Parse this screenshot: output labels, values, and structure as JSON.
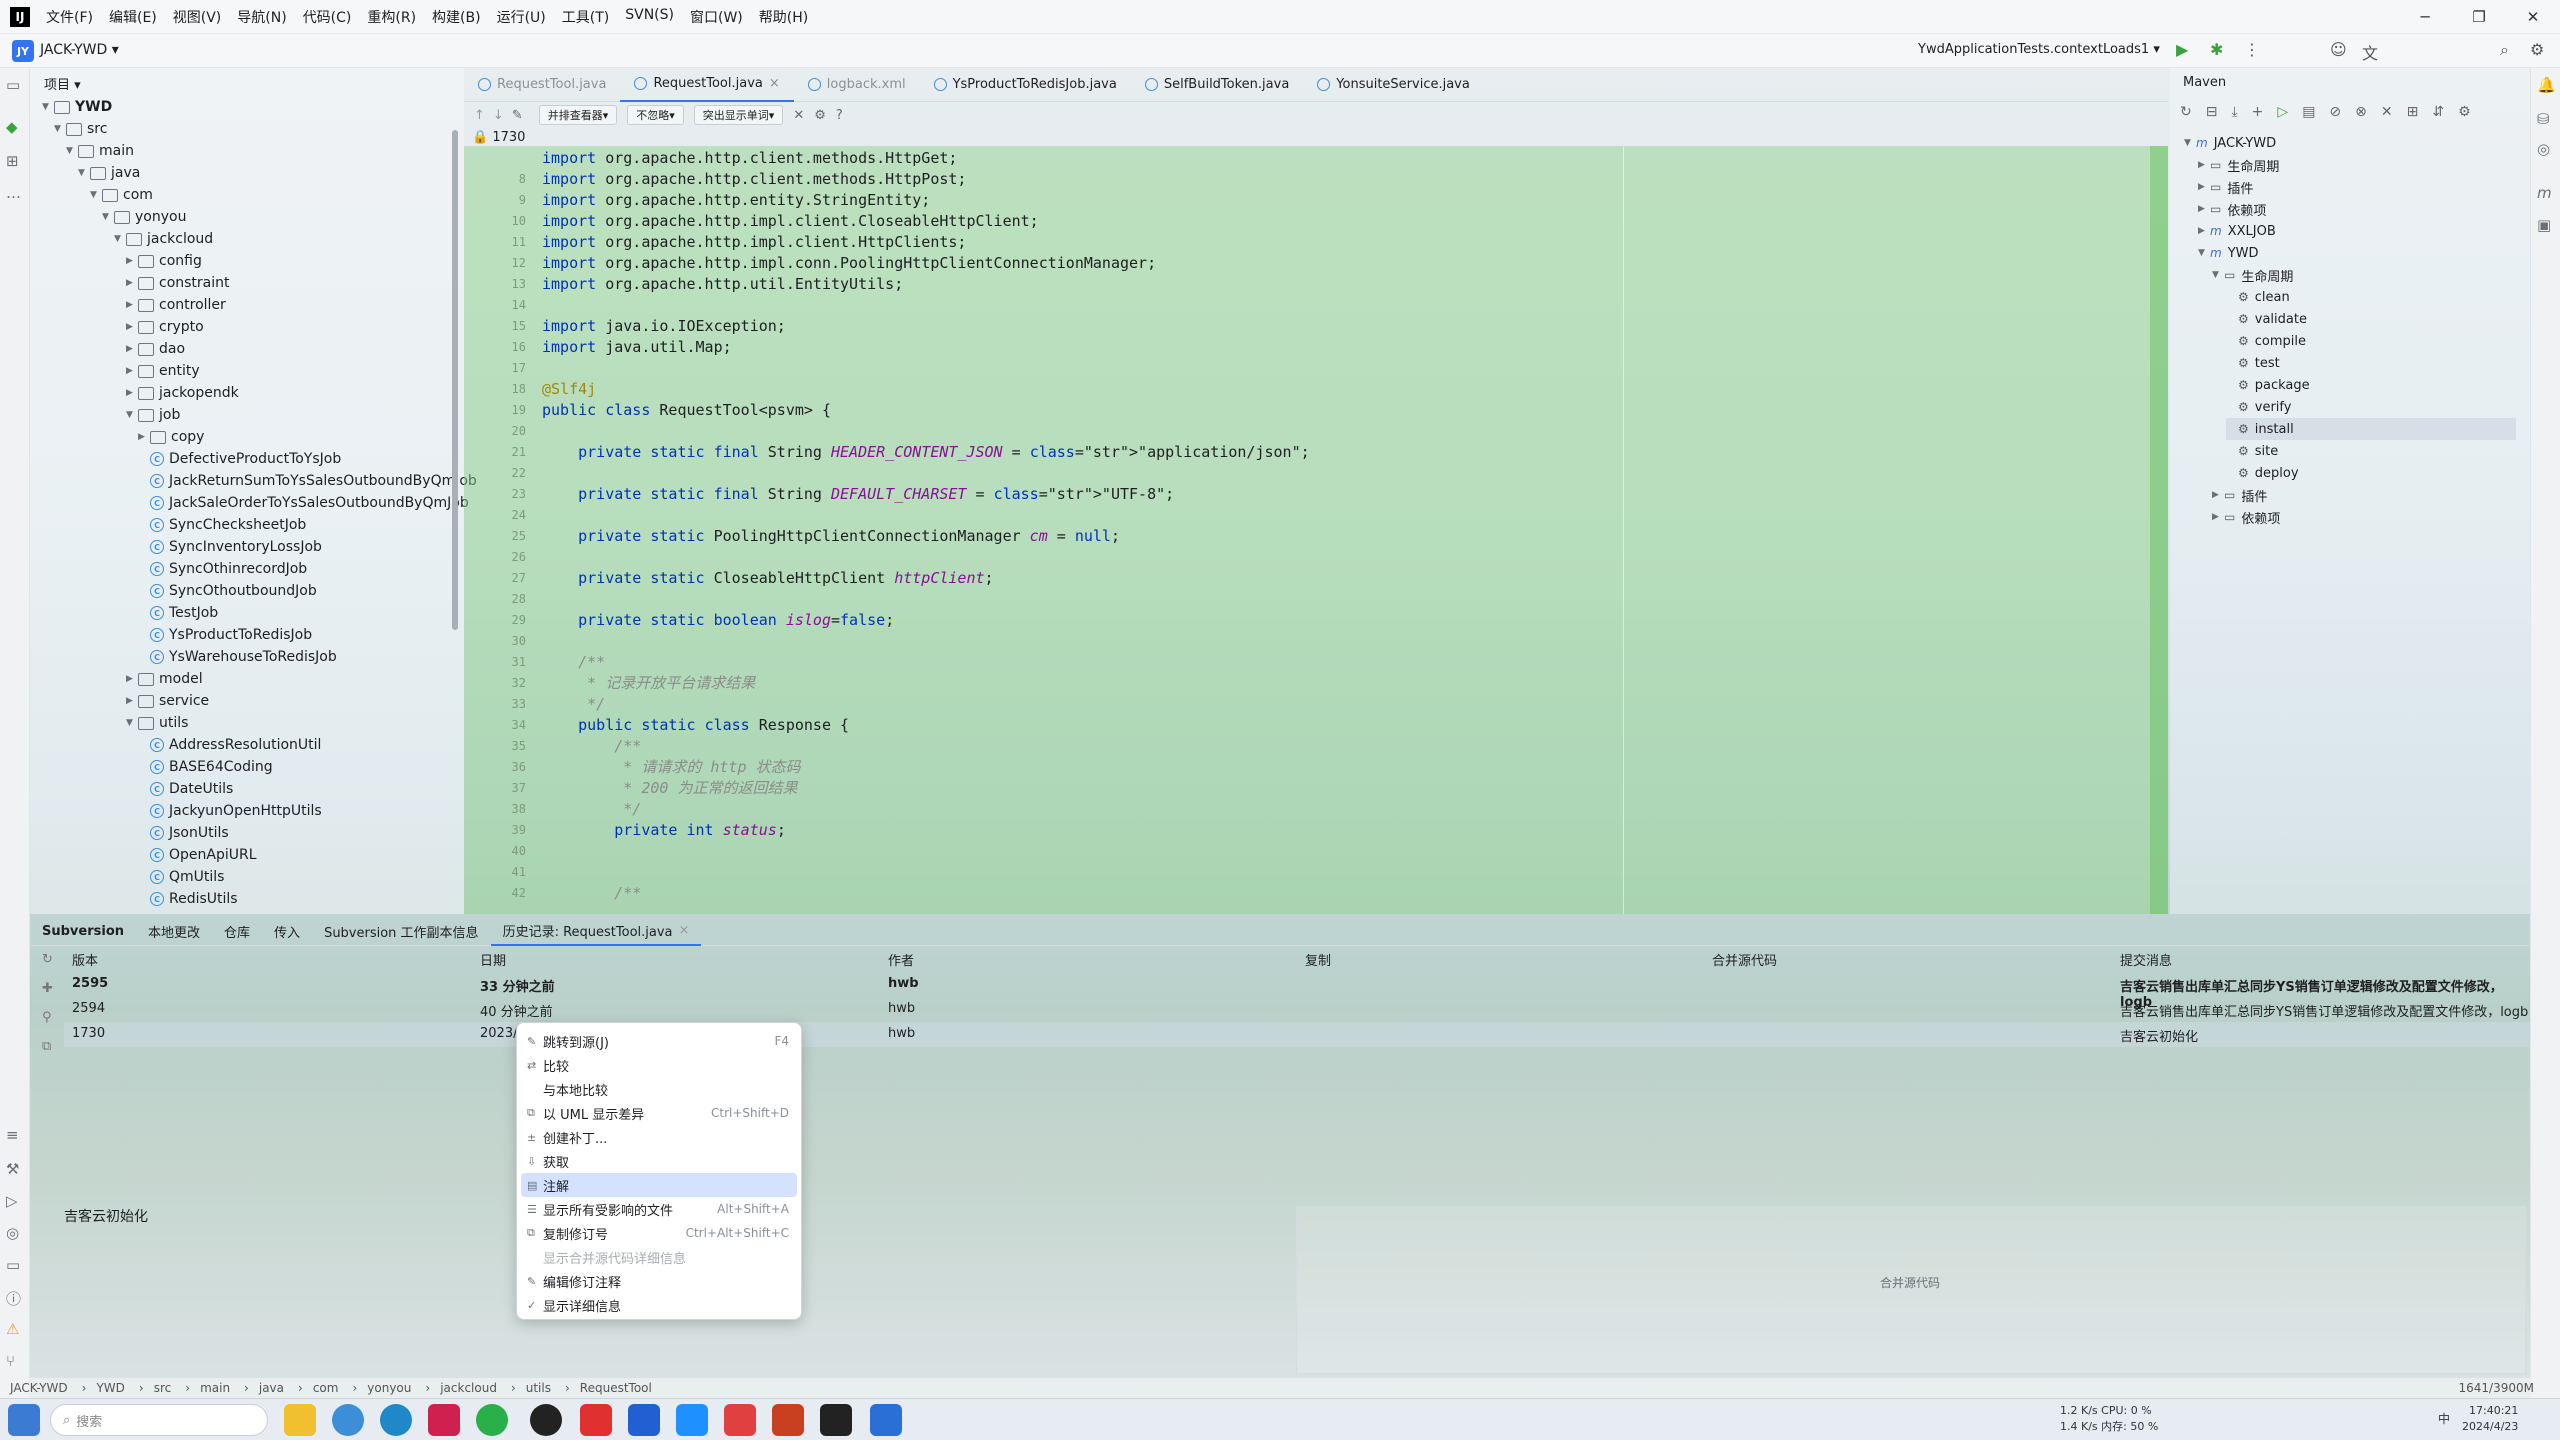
{
  "menu": [
    "文件(F)",
    "编辑(E)",
    "视图(V)",
    "导航(N)",
    "代码(C)",
    "重构(R)",
    "构建(B)",
    "运行(U)",
    "工具(T)",
    "SVN(S)",
    "窗口(W)",
    "帮助(H)"
  ],
  "project": {
    "badge": "JY",
    "name": "JACK-YWD",
    "panel_title": "项目"
  },
  "run_config": "YwdApplicationTests.contextLoads1",
  "tree": [
    {
      "label": "YWD",
      "depth": 1,
      "kind": "folder",
      "open": true,
      "bold": true
    },
    {
      "label": "src",
      "depth": 2,
      "kind": "folder",
      "open": true
    },
    {
      "label": "main",
      "depth": 3,
      "kind": "folder",
      "open": true
    },
    {
      "label": "java",
      "depth": 4,
      "kind": "folder",
      "open": true
    },
    {
      "label": "com",
      "depth": 5,
      "kind": "folder",
      "open": true
    },
    {
      "label": "yonyou",
      "depth": 6,
      "kind": "folder",
      "open": true
    },
    {
      "label": "jackcloud",
      "depth": 7,
      "kind": "folder",
      "open": true
    },
    {
      "label": "config",
      "depth": 8,
      "kind": "folder"
    },
    {
      "label": "constraint",
      "depth": 8,
      "kind": "folder"
    },
    {
      "label": "controller",
      "depth": 8,
      "kind": "folder"
    },
    {
      "label": "crypto",
      "depth": 8,
      "kind": "folder"
    },
    {
      "label": "dao",
      "depth": 8,
      "kind": "folder"
    },
    {
      "label": "entity",
      "depth": 8,
      "kind": "folder"
    },
    {
      "label": "jackopendk",
      "depth": 8,
      "kind": "folder"
    },
    {
      "label": "job",
      "depth": 8,
      "kind": "folder",
      "open": true
    },
    {
      "label": "copy",
      "depth": 9,
      "kind": "folder"
    },
    {
      "label": "DefectiveProductToYsJob",
      "depth": 9,
      "kind": "class"
    },
    {
      "label": "JackReturnSumToYsSalesOutboundByQmJob",
      "depth": 9,
      "kind": "class"
    },
    {
      "label": "JackSaleOrderToYsSalesOutboundByQmJob",
      "depth": 9,
      "kind": "class"
    },
    {
      "label": "SyncChecksheetJob",
      "depth": 9,
      "kind": "class"
    },
    {
      "label": "SyncInventoryLossJob",
      "depth": 9,
      "kind": "class"
    },
    {
      "label": "SyncOthinrecordJob",
      "depth": 9,
      "kind": "class"
    },
    {
      "label": "SyncOthoutboundJob",
      "depth": 9,
      "kind": "class"
    },
    {
      "label": "TestJob",
      "depth": 9,
      "kind": "class"
    },
    {
      "label": "YsProductToRedisJob",
      "depth": 9,
      "kind": "class"
    },
    {
      "label": "YsWarehouseToRedisJob",
      "depth": 9,
      "kind": "class"
    },
    {
      "label": "model",
      "depth": 8,
      "kind": "folder"
    },
    {
      "label": "service",
      "depth": 8,
      "kind": "folder"
    },
    {
      "label": "utils",
      "depth": 8,
      "kind": "folder",
      "open": true
    },
    {
      "label": "AddressResolutionUtil",
      "depth": 9,
      "kind": "class"
    },
    {
      "label": "BASE64Coding",
      "depth": 9,
      "kind": "class"
    },
    {
      "label": "DateUtils",
      "depth": 9,
      "kind": "class"
    },
    {
      "label": "JackyunOpenHttpUtils",
      "depth": 9,
      "kind": "class"
    },
    {
      "label": "JsonUtils",
      "depth": 9,
      "kind": "class"
    },
    {
      "label": "OpenApiURL",
      "depth": 9,
      "kind": "class"
    },
    {
      "label": "QmUtils",
      "depth": 9,
      "kind": "class"
    },
    {
      "label": "RedisUtils",
      "depth": 9,
      "kind": "class"
    }
  ],
  "tabs": [
    {
      "label": "RequestTool.java",
      "state": "dim"
    },
    {
      "label": "RequestTool.java",
      "state": "active"
    },
    {
      "label": "logback.xml",
      "state": "dim"
    },
    {
      "label": "YsProductToRedisJob.java",
      "state": "normal"
    },
    {
      "label": "SelfBuildToken.java",
      "state": "normal"
    },
    {
      "label": "YonsuiteService.java",
      "state": "normal"
    }
  ],
  "editor_toolbar": [
    "并排查看器",
    "不忽略",
    "突出显示单词"
  ],
  "revision_label": "1730",
  "code_lines": [
    {
      "n": "",
      "t": "import org.apache.http.client.methods.HttpGet;"
    },
    {
      "n": "8",
      "t": "import org.apache.http.client.methods.HttpPost;"
    },
    {
      "n": "9",
      "t": "import org.apache.http.entity.StringEntity;"
    },
    {
      "n": "10",
      "t": "import org.apache.http.impl.client.CloseableHttpClient;"
    },
    {
      "n": "11",
      "t": "import org.apache.http.impl.client.HttpClients;"
    },
    {
      "n": "12",
      "t": "import org.apache.http.impl.conn.PoolingHttpClientConnectionManager;"
    },
    {
      "n": "13",
      "t": "import org.apache.http.util.EntityUtils;"
    },
    {
      "n": "14",
      "t": ""
    },
    {
      "n": "15",
      "t": "import java.io.IOException;"
    },
    {
      "n": "16",
      "t": "import java.util.Map;"
    },
    {
      "n": "17",
      "t": ""
    },
    {
      "n": "18",
      "t": "@Slf4j"
    },
    {
      "n": "19",
      "t": "public class RequestTool<psvm> {"
    },
    {
      "n": "20",
      "t": ""
    },
    {
      "n": "21",
      "t": "    private static final String HEADER_CONTENT_JSON = \"application/json\";"
    },
    {
      "n": "22",
      "t": ""
    },
    {
      "n": "23",
      "t": "    private static final String DEFAULT_CHARSET = \"UTF-8\";"
    },
    {
      "n": "24",
      "t": ""
    },
    {
      "n": "25",
      "t": "    private static PoolingHttpClientConnectionManager cm = null;"
    },
    {
      "n": "26",
      "t": ""
    },
    {
      "n": "27",
      "t": "    private static CloseableHttpClient httpClient;"
    },
    {
      "n": "28",
      "t": ""
    },
    {
      "n": "29",
      "t": "    private static boolean islog=false;"
    },
    {
      "n": "30",
      "t": ""
    },
    {
      "n": "31",
      "t": "    /**"
    },
    {
      "n": "32",
      "t": "     * 记录开放平台请求结果"
    },
    {
      "n": "33",
      "t": "     */"
    },
    {
      "n": "34",
      "t": "    public static class Response {"
    },
    {
      "n": "35",
      "t": "        /**"
    },
    {
      "n": "36",
      "t": "         * 请请求的 http 状态码"
    },
    {
      "n": "37",
      "t": "         * 200 为正常的返回结果"
    },
    {
      "n": "38",
      "t": "         */"
    },
    {
      "n": "39",
      "t": "        private int status;"
    },
    {
      "n": "40",
      "t": ""
    },
    {
      "n": "41",
      "t": ""
    },
    {
      "n": "42",
      "t": "        /**"
    }
  ],
  "maven": {
    "title": "Maven",
    "rows": [
      {
        "label": "JACK-YWD",
        "depth": 0,
        "kind": "m",
        "open": true
      },
      {
        "label": "生命周期",
        "depth": 1,
        "kind": "folder"
      },
      {
        "label": "插件",
        "depth": 1,
        "kind": "folder"
      },
      {
        "label": "依赖项",
        "depth": 1,
        "kind": "folder"
      },
      {
        "label": "XXLJOB",
        "depth": 1,
        "kind": "m"
      },
      {
        "label": "YWD",
        "depth": 1,
        "kind": "m",
        "open": true
      },
      {
        "label": "生命周期",
        "depth": 2,
        "kind": "folder",
        "open": true
      },
      {
        "label": "clean",
        "depth": 3,
        "kind": "gear"
      },
      {
        "label": "validate",
        "depth": 3,
        "kind": "gear"
      },
      {
        "label": "compile",
        "depth": 3,
        "kind": "gear"
      },
      {
        "label": "test",
        "depth": 3,
        "kind": "gear"
      },
      {
        "label": "package",
        "depth": 3,
        "kind": "gear"
      },
      {
        "label": "verify",
        "depth": 3,
        "kind": "gear"
      },
      {
        "label": "install",
        "depth": 3,
        "kind": "gear",
        "sel": true
      },
      {
        "label": "site",
        "depth": 3,
        "kind": "gear"
      },
      {
        "label": "deploy",
        "depth": 3,
        "kind": "gear"
      },
      {
        "label": "插件",
        "depth": 2,
        "kind": "folder"
      },
      {
        "label": "依赖项",
        "depth": 2,
        "kind": "folder"
      }
    ]
  },
  "bottom_tabs": [
    "Subversion",
    "本地更改",
    "仓库",
    "传入",
    "Subversion 工作副本信息",
    "历史记录: RequestTool.java"
  ],
  "history": {
    "columns": [
      "版本",
      "日期",
      "作者",
      "复制",
      "合并源代码",
      "提交消息"
    ],
    "rows": [
      {
        "rev": "2595",
        "date": "33 分钟之前",
        "author": "hwb",
        "msg": "吉客云销售出库单汇总同步YS销售订单逻辑修改及配置文件修改，logb",
        "bold": true
      },
      {
        "rev": "2594",
        "date": "40 分钟之前",
        "author": "hwb",
        "msg": "吉客云销售出库单汇总同步YS销售订单逻辑修改及配置文件修改，logb",
        "bold": false
      },
      {
        "rev": "1730",
        "date": "2023/",
        "author": "hwb",
        "msg": "吉客云初始化",
        "bold": false
      }
    ],
    "detail_text": "吉客云初始化",
    "merge_label": "合并源代码"
  },
  "context_menu": [
    {
      "label": "跳转到源(J)",
      "shortcut": "F4",
      "icon": "✎"
    },
    {
      "label": "比较",
      "shortcut": "",
      "icon": "⇄"
    },
    {
      "label": "与本地比较",
      "shortcut": "",
      "icon": ""
    },
    {
      "label": "以 UML 显示差异",
      "shortcut": "Ctrl+Shift+D",
      "icon": "⧉"
    },
    {
      "label": "创建补丁...",
      "shortcut": "",
      "icon": "±"
    },
    {
      "label": "获取",
      "shortcut": "",
      "icon": "⇩"
    },
    {
      "label": "注解",
      "shortcut": "",
      "icon": "▤",
      "highlight": true
    },
    {
      "label": "显示所有受影响的文件",
      "shortcut": "Alt+Shift+A",
      "icon": "☰"
    },
    {
      "label": "复制修订号",
      "shortcut": "Ctrl+Alt+Shift+C",
      "icon": "⧉"
    },
    {
      "label": "显示合并源代码详细信息",
      "shortcut": "",
      "icon": "",
      "disabled": true
    },
    {
      "label": "编辑修订注释",
      "shortcut": "",
      "icon": "✎"
    },
    {
      "label": "显示详细信息",
      "shortcut": "",
      "icon": "✓"
    }
  ],
  "breadcrumb": [
    "JACK-YWD",
    "YWD",
    "src",
    "main",
    "java",
    "com",
    "yonyou",
    "jackcloud",
    "utils",
    "RequestTool"
  ],
  "memory": "1641/3900M",
  "taskbar": {
    "search_placeholder": "搜索",
    "net": "1.2 K/s CPU: 0 %",
    "net2": "1.4 K/s 内存: 50 %",
    "time": "17:40:21",
    "date": "2024/4/23",
    "lang": "中"
  },
  "colors": {
    "accent": "#3574f0",
    "diff_green": "#90d48a"
  }
}
